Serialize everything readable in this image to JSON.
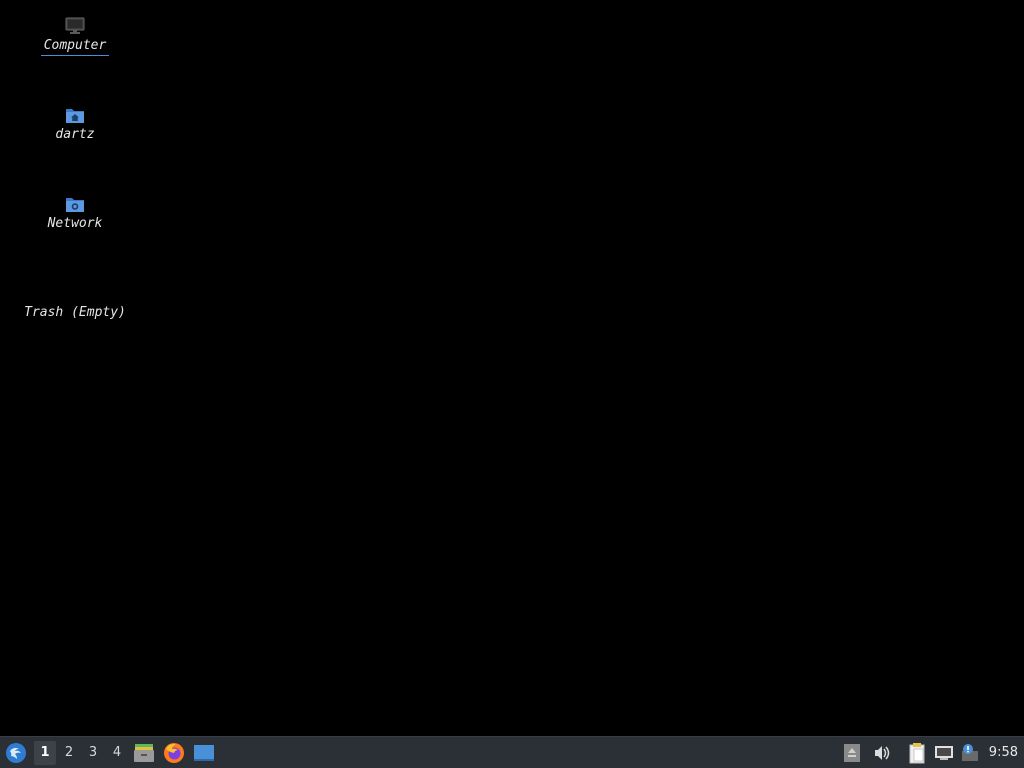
{
  "desktop": {
    "icons": [
      {
        "name": "Computer",
        "icon": "computer-icon",
        "selected": true
      },
      {
        "name": "dartz",
        "icon": "home-folder-icon"
      },
      {
        "name": "Network",
        "icon": "network-folder-icon"
      },
      {
        "name": "Trash (Empty)",
        "icon": "trash-icon"
      }
    ]
  },
  "taskbar": {
    "start_icon": "lxqt-start-icon",
    "workspaces": [
      "1",
      "2",
      "3",
      "4"
    ],
    "active_workspace": "1",
    "launchers": [
      {
        "icon": "file-manager-icon"
      },
      {
        "icon": "firefox-icon"
      },
      {
        "icon": "show-desktop-icon"
      }
    ],
    "tray": [
      {
        "icon": "eject-icon"
      },
      {
        "icon": "volume-icon"
      },
      {
        "icon": "clipboard-icon"
      },
      {
        "icon": "network-wired-icon"
      },
      {
        "icon": "update-notifier-icon"
      }
    ],
    "clock": "9:58"
  },
  "colors": {
    "desktop_bg": "#000000",
    "taskbar_bg": "#2b2f36",
    "accent": "#4a90d9",
    "folder_blue": "#4f8fd8"
  }
}
